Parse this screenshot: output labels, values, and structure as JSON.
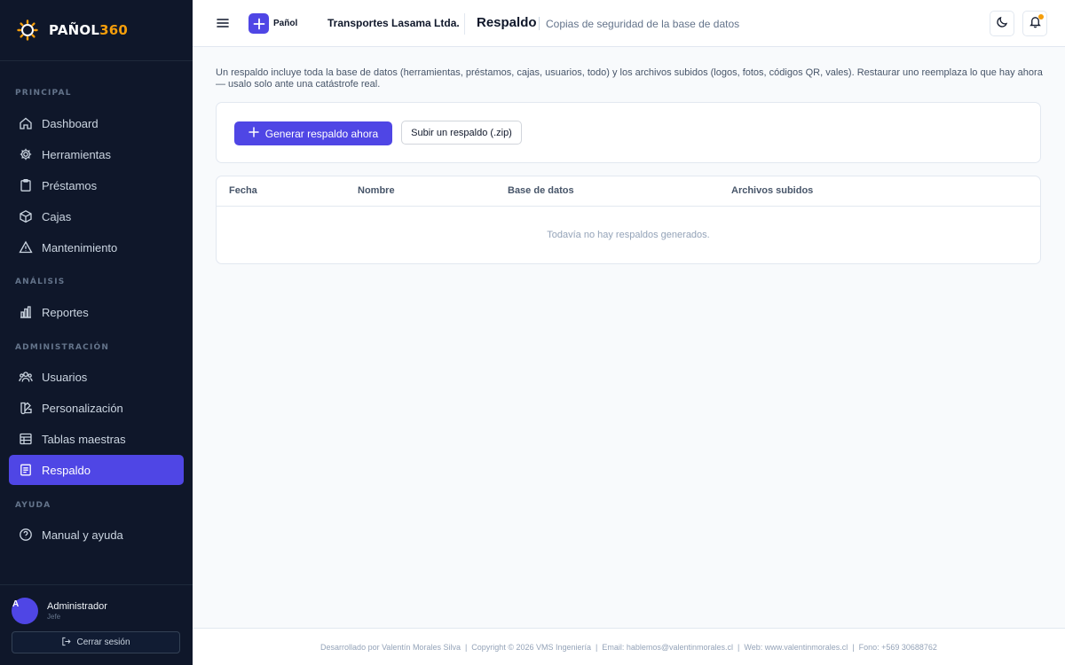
{
  "sidebar": {
    "brand": {
      "name": "PAÑOL",
      "accent": "360"
    },
    "sections": {
      "principal": "PRINCIPAL",
      "analisis": "ANÁLISIS",
      "administracion": "ADMINISTRACIÓN",
      "ayuda": "AYUDA"
    },
    "items": {
      "dashboard": "Dashboard",
      "herramientas": "Herramientas",
      "prestamos": "Préstamos",
      "cajas": "Cajas",
      "mantenimiento": "Mantenimiento",
      "reportes": "Reportes",
      "usuarios": "Usuarios",
      "personalizacion": "Personalización",
      "tablas": "Tablas maestras",
      "respaldo": "Respaldo",
      "manual": "Manual y ayuda"
    },
    "user": {
      "initial": "A",
      "name": "Administrador",
      "role": "Jefe"
    },
    "logout_label": "Cerrar sesión"
  },
  "header": {
    "app_label": "Pañol",
    "company": "Transportes Lasama Ltda.",
    "title": "Respaldo",
    "subtitle": "Copias de seguridad de la base de datos"
  },
  "main": {
    "intro": "Un respaldo incluye toda la base de datos (herramientas, préstamos, cajas, usuarios, todo) y los archivos subidos (logos, fotos, códigos QR, vales). Restaurar uno reemplaza lo que hay ahora — usalo solo ante una catástrofe real.",
    "generate_label": "Generar respaldo ahora",
    "upload_label": "Subir un respaldo (.zip)",
    "table": {
      "columns": [
        "Fecha",
        "Nombre",
        "Base de datos",
        "Archivos subidos"
      ],
      "rows": [],
      "empty": "Todavía no hay respaldos generados."
    }
  },
  "footer": {
    "text": "Desarrollado por Valentín Morales Silva  |  Copyright © 2026 VMS Ingeniería  |  Email: hablemos@valentinmorales.cl  |  Web: www.valentinmorales.cl  |  Fono: +569 30688762"
  },
  "colors": {
    "sidebar_bg": "#0f172a",
    "accent": "#4f46e5",
    "brand_accent": "#f59e0b"
  }
}
